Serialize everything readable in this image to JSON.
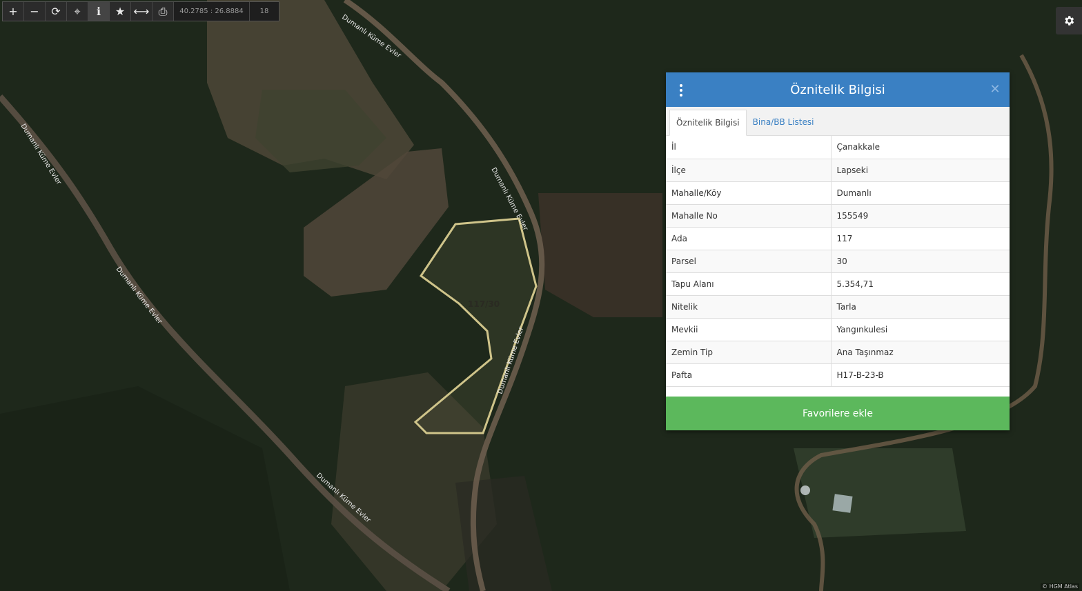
{
  "toolbar": {
    "buttons": [
      {
        "name": "zoom-in-button",
        "icon": "plus-icon",
        "glyph": "+"
      },
      {
        "name": "zoom-out-button",
        "icon": "minus-icon",
        "glyph": "−"
      },
      {
        "name": "refresh-button",
        "icon": "refresh-icon",
        "glyph": "⟳"
      },
      {
        "name": "locate-button",
        "icon": "crosshair-icon",
        "glyph": "⌖"
      },
      {
        "name": "info-button",
        "icon": "info-icon",
        "glyph": "i"
      },
      {
        "name": "favorite-button",
        "icon": "star-icon",
        "glyph": "★"
      },
      {
        "name": "measure-button",
        "icon": "measure-icon",
        "glyph": "⟷"
      },
      {
        "name": "print-button",
        "icon": "printer-icon",
        "glyph": "⎙"
      }
    ],
    "coordinates": "40.2785 : 26.8884",
    "zoom_level": "18"
  },
  "map": {
    "parcel_label": "117/30",
    "road_labels": [
      "Dumanlı Küme Evler",
      "Dumanlı Küme Evler",
      "Dumanlı Küme Evler",
      "Dumanlı Küme Evler",
      "Dumanlı Küme Evler",
      "Dumanlı Küme Evler"
    ],
    "attribution": "© HGM Atlas"
  },
  "panel": {
    "title": "Öznitelik Bilgisi",
    "tabs": [
      {
        "label": "Öznitelik Bilgisi",
        "active": true
      },
      {
        "label": "Bina/BB Listesi",
        "active": false
      }
    ],
    "rows": [
      {
        "key": "İl",
        "value": "Çanakkale"
      },
      {
        "key": "İlçe",
        "value": "Lapseki"
      },
      {
        "key": "Mahalle/Köy",
        "value": "Dumanlı"
      },
      {
        "key": "Mahalle No",
        "value": "155549"
      },
      {
        "key": "Ada",
        "value": "117"
      },
      {
        "key": "Parsel",
        "value": "30"
      },
      {
        "key": "Tapu Alanı",
        "value": "5.354,71"
      },
      {
        "key": "Nitelik",
        "value": "Tarla"
      },
      {
        "key": "Mevkii",
        "value": "Yangınkulesi"
      },
      {
        "key": "Zemin Tip",
        "value": "Ana Taşınmaz"
      },
      {
        "key": "Pafta",
        "value": "H17-B-23-B"
      }
    ],
    "favorite_button": "Favorilere ekle"
  },
  "colors": {
    "header_blue": "#3a80c3",
    "button_green": "#5cb85c",
    "parcel_outline": "#cfc48a"
  }
}
